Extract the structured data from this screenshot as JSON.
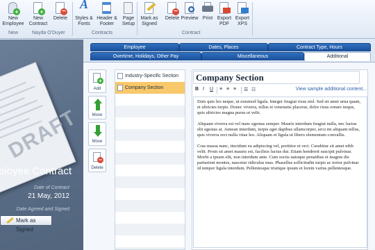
{
  "ribbon": {
    "new_label": "New Employee",
    "new_contract_label": "New Contract",
    "delete_label": "Delete",
    "styles_label": "Styles & Fonts",
    "header_footer_label": "Header & Footer",
    "page_setup_label": "Page Setup",
    "mark_signed_label": "Mark as Signed",
    "delete2_label": "Delete",
    "preview_label": "Preview",
    "print_label": "Print",
    "export_pdf_label": "Export PDF",
    "export_xps_label": "Export XPS",
    "group_new": "New",
    "group_user": "Nayda O'Duyer",
    "group_contracts": "Contracts",
    "group_contract": "Contract"
  },
  "left": {
    "watermark": "DRAFT",
    "title": "ployee Contract",
    "date_label": "Date of Contract",
    "date_value": "21 May, 2012",
    "agreed_label": "Date Agreed and Signed",
    "mark_signed": "Mark as Signed"
  },
  "tabs": {
    "row1": [
      "Employee",
      "Dates, Places",
      "Contract Type, Hours"
    ],
    "row2": [
      "Overtime, Holidays, Other Pay",
      "Miscellaneous",
      "Additional"
    ]
  },
  "tools": {
    "add": "Add",
    "move_up": "Move",
    "move_down": "Move",
    "delete": "Delete"
  },
  "sections": [
    "Industry-Specific Section",
    "Company Section"
  ],
  "editor": {
    "title": "Company Section",
    "bold": "B",
    "italic": "I",
    "underline": "U",
    "sample_link": "View sample additional content...",
    "paragraphs": [
      "Duis quis leo neque, ut euismod ligula. Integer feugiat risus nisl. Sed sit amet urna quam, et ultricies turpis. Donec viverra, tellus et venenatis placerat, dolor risus ornare neque, quis ultricies magna purus ut velit.",
      "Aliquam viverra est vel nunc egestas semper. Mauris interdum feugiat nulla, nec luctus elit egestas at. Aenean interdum, turpis eget dapibus ullamcorper, arcu mi aliquam tellus, quis viverra orci nulla vitae leo. Aliquam et ligula ut libero elementum convallis.",
      "Cras massa nunc, tincidunt eu adipiscing vel, porttitor et orci. Curabitur sit amet nibh velit. Proin sit amet mauris est, facilisis luctus dui. Etiam hendrerit suscipit pulvinar. Morbi a ipsum elit, non interdum ante. Cum sociis natoque penatibus et magnis dis parturient montes, nascetur ridiculus mus. Phasellus sollicitudin turpis ac tortor pulvinar id tempor ligula interdum. Pellentesque tristique ipsum et lorem varius pellentesque."
    ]
  },
  "colors": {
    "tab_blue": "#1f5aa8",
    "selected_item": "#f8c86b",
    "left_panel": "#5b6e88"
  }
}
